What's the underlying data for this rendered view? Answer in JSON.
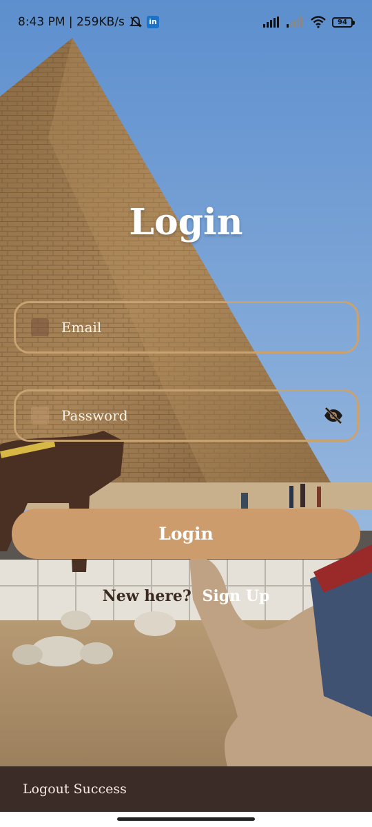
{
  "status_bar": {
    "time_speed": "8:43 PM | 259KB/s",
    "app_badge": "in",
    "battery": "94"
  },
  "login": {
    "title": "Login",
    "email_placeholder": "Email",
    "password_placeholder": "Password",
    "button_label": "Login",
    "signup_prompt": "New here?",
    "signup_link": "Sign Up"
  },
  "snackbar": {
    "message": "Logout Success"
  },
  "colors": {
    "accent": "#cd9c6d",
    "field_border": "#c9a272",
    "snackbar_bg": "#3c2c28"
  },
  "icons": {
    "status": [
      "mute-icon",
      "linkedin-icon",
      "signal-icon",
      "wifi-icon",
      "battery-icon"
    ],
    "password_toggle": "eye-off-icon"
  }
}
